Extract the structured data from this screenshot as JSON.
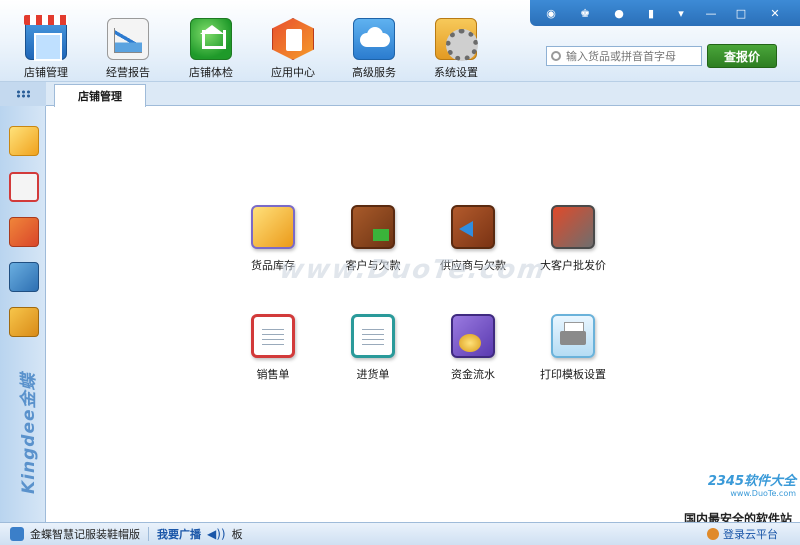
{
  "toolbar": {
    "items": [
      {
        "label": "店铺管理",
        "icon": "storefront-icon"
      },
      {
        "label": "经营报告",
        "icon": "report-chart-icon"
      },
      {
        "label": "店铺体检",
        "icon": "health-check-icon"
      },
      {
        "label": "应用中心",
        "icon": "app-center-icon"
      },
      {
        "label": "高级服务",
        "icon": "cloud-service-icon"
      },
      {
        "label": "系统设置",
        "icon": "settings-gear-icon"
      }
    ]
  },
  "window_controls": {
    "skin": "◉",
    "account": "♚",
    "message": "●",
    "gift": "▮",
    "menu": "▾",
    "minimize": "—",
    "maximize": "□",
    "close": "✕"
  },
  "search": {
    "placeholder": "输入货品或拼音首字母",
    "button_label": "查报价"
  },
  "tabs": [
    {
      "label": "店铺管理"
    }
  ],
  "sidebar": {
    "items": [
      {
        "name": "goods-icon"
      },
      {
        "name": "calendar-icon"
      },
      {
        "name": "contacts-icon"
      },
      {
        "name": "photo-icon"
      },
      {
        "name": "notebook-icon"
      }
    ],
    "brand": "Kingdee金蝶"
  },
  "functions": [
    {
      "label": "货品库存",
      "icon": "inventory-boxes-icon"
    },
    {
      "label": "客户与欠款",
      "icon": "customer-debt-icon"
    },
    {
      "label": "供应商与欠款",
      "icon": "supplier-debt-icon"
    },
    {
      "label": "大客户批发价",
      "icon": "price-tag-icon"
    },
    {
      "label": "销售单",
      "icon": "sales-order-icon"
    },
    {
      "label": "进货单",
      "icon": "purchase-order-icon"
    },
    {
      "label": "资金流水",
      "icon": "cash-flow-icon"
    },
    {
      "label": "打印模板设置",
      "icon": "printer-icon"
    }
  ],
  "watermark": {
    "center": "www.DuoTe.com",
    "corner_top": "2345软件大全",
    "corner_sub": "www.DuoTe.com",
    "corner_bottom": "国内最安全的软件站"
  },
  "statusbar": {
    "edition": "金蝶智慧记服装鞋帽版",
    "broadcast_label": "我要广播",
    "speaker": "◀))",
    "ticker": "板",
    "login_label": "登录云平台"
  }
}
